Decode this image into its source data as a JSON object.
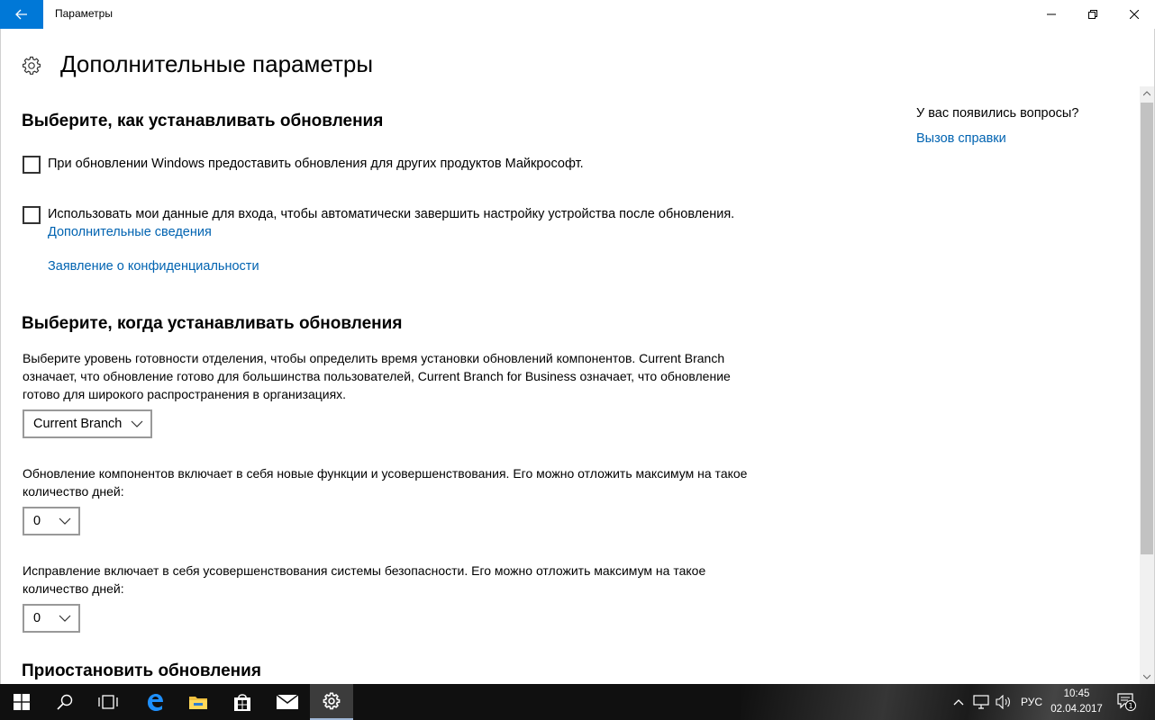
{
  "titlebar": {
    "app_title": "Параметры",
    "back_icon": "arrow-left-icon",
    "minimize_icon": "minimize-icon",
    "maximize_icon": "restore-icon",
    "close_icon": "close-icon"
  },
  "header": {
    "icon": "gear-icon",
    "title": "Дополнительные параметры"
  },
  "section_install_how": {
    "title": "Выберите, как устанавливать обновления",
    "checkbox_other_products": {
      "label": "При обновлении Windows предоставить обновления для других продуктов Майкрософт.",
      "checked": false
    },
    "checkbox_signin_data": {
      "label": "Использовать мои данные для входа, чтобы автоматически завершить настройку устройства после обновления.",
      "checked": false
    },
    "link_more_info": "Дополнительные сведения",
    "link_privacy": "Заявление о конфиденциальности"
  },
  "section_install_when": {
    "title": "Выберите, когда устанавливать обновления",
    "description": "Выберите уровень готовности отделения, чтобы определить время установки обновлений компонентов. Current Branch означает, что обновление готово для большинства пользователей, Current Branch for Business означает, что обновление готово для широкого распространения в организациях.",
    "branch_select": "Current Branch",
    "feature_defer_text": "Обновление компонентов включает в себя новые функции и усовершенствования. Его можно отложить максимум на такое количество дней:",
    "feature_defer_value": "0",
    "quality_defer_text": "Исправление включает в себя усовершенствования системы безопасности. Его можно отложить максимум на такое количество дней:",
    "quality_defer_value": "0"
  },
  "section_pause": {
    "title": "Приостановить обновления"
  },
  "side": {
    "question": "У вас появились вопросы?",
    "help_link": "Вызов справки"
  },
  "taskbar": {
    "items": [
      "start-icon",
      "search-icon",
      "task-view-icon",
      "edge-icon",
      "file-explorer-icon",
      "store-icon",
      "mail-icon",
      "settings-icon"
    ],
    "tray": {
      "language": "РУС",
      "time": "10:45",
      "date": "02.04.2017",
      "notification_count": "1"
    }
  },
  "colors": {
    "accent": "#0078d7",
    "link": "#0063b1",
    "taskbar": "#101010"
  }
}
